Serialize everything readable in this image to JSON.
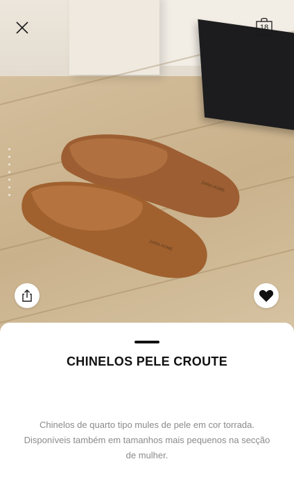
{
  "header": {
    "close_icon": "close-icon",
    "bag_icon": "shopping-bag-icon",
    "bag_count": "18"
  },
  "hero": {
    "image": "brown-suede-slippers-photo",
    "share_icon": "share-icon",
    "favorite_icon": "heart-icon",
    "image_pages_visible": 7,
    "slipper_insole_brand": "ZARA HOME"
  },
  "product": {
    "title": "CHINELOS PELE CROUTE",
    "description": "Chinelos de quarto tipo mules de pele em cor torrada. Disponíveis também em tamanhos mais pequenos na secção de mulher."
  },
  "colors": {
    "text_primary": "#111111",
    "text_secondary": "#8a8a8a",
    "slipper": "#a8683a"
  }
}
